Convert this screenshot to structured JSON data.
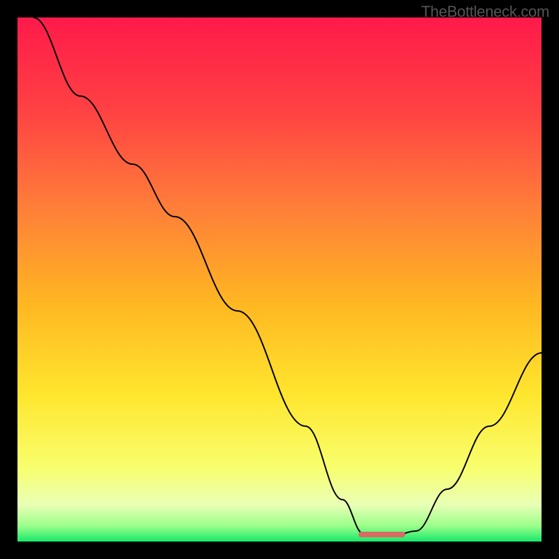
{
  "watermark": "TheBottleneck.com",
  "chart_data": {
    "type": "line",
    "title": "",
    "xlabel": "",
    "ylabel": "",
    "xlim": [
      0,
      100
    ],
    "ylim": [
      0,
      100
    ],
    "gradient_stops": [
      {
        "offset": 0,
        "color": "#ff1a4a"
      },
      {
        "offset": 18,
        "color": "#ff4243"
      },
      {
        "offset": 35,
        "color": "#ff7a3a"
      },
      {
        "offset": 55,
        "color": "#ffb822"
      },
      {
        "offset": 72,
        "color": "#ffe62e"
      },
      {
        "offset": 86,
        "color": "#f8ff6e"
      },
      {
        "offset": 93,
        "color": "#e9ffb6"
      },
      {
        "offset": 97,
        "color": "#9bff8a"
      },
      {
        "offset": 100,
        "color": "#17e86b"
      }
    ],
    "series": [
      {
        "name": "bottleneck-curve",
        "points": [
          {
            "x": 3,
            "y": 100
          },
          {
            "x": 12,
            "y": 85
          },
          {
            "x": 22,
            "y": 72
          },
          {
            "x": 30,
            "y": 62
          },
          {
            "x": 42,
            "y": 44
          },
          {
            "x": 55,
            "y": 22
          },
          {
            "x": 62,
            "y": 8
          },
          {
            "x": 66,
            "y": 1.5
          },
          {
            "x": 72,
            "y": 1.2
          },
          {
            "x": 76,
            "y": 2
          },
          {
            "x": 82,
            "y": 10
          },
          {
            "x": 90,
            "y": 22
          },
          {
            "x": 100,
            "y": 36
          }
        ]
      }
    ],
    "optimal_marker": {
      "x_start": 65,
      "x_end": 74,
      "y": 1.3
    },
    "annotations": []
  }
}
